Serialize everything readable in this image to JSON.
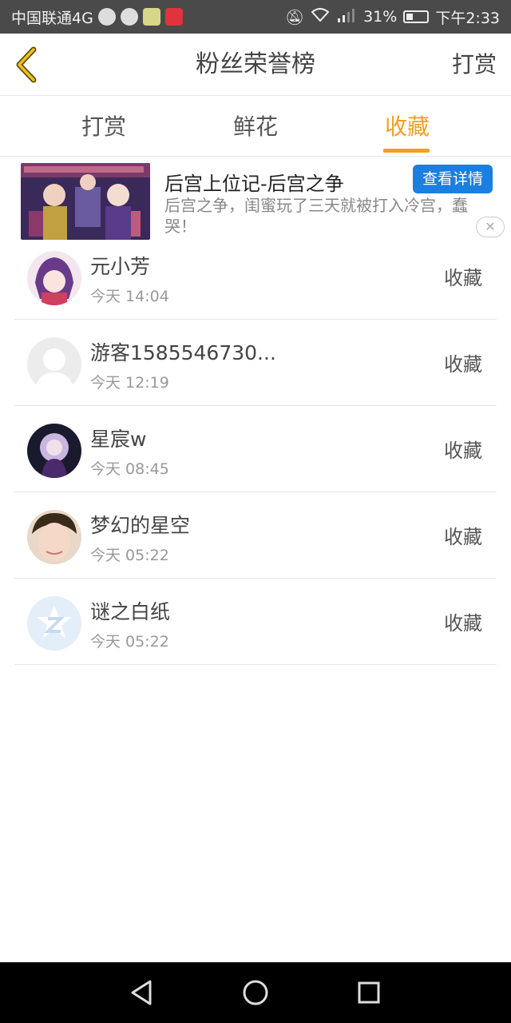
{
  "status_bar": {
    "carrier": "中国联通4G",
    "network": "4G",
    "battery": "31%",
    "time": "下午2:33"
  },
  "header": {
    "title": "粉丝荣誉榜",
    "right_action": "打赏"
  },
  "tabs": [
    {
      "label": "打赏",
      "active": false
    },
    {
      "label": "鲜花",
      "active": false
    },
    {
      "label": "收藏",
      "active": true
    }
  ],
  "accent_color": "#f0a020",
  "ad": {
    "title": "后宫上位记-后宫之争",
    "button": "查看详情",
    "description": "后宫之争，闺蜜玩了三天就被打入冷宫，蠢哭！",
    "close_symbol": "✕"
  },
  "list": [
    {
      "name": "元小芳",
      "time": "今天 14:04",
      "action": "收藏",
      "avatar": "anime-girl-avatar"
    },
    {
      "name": "游客1585546730...",
      "time": "今天 12:19",
      "action": "收藏",
      "avatar": "default-avatar"
    },
    {
      "name": "星宸w",
      "time": "今天 08:45",
      "action": "收藏",
      "avatar": "dark-anime-avatar"
    },
    {
      "name": "梦幻的星空",
      "time": "今天 05:22",
      "action": "收藏",
      "avatar": "photo-avatar"
    },
    {
      "name": "谜之白纸",
      "time": "今天 05:22",
      "action": "收藏",
      "avatar": "z-logo-avatar"
    }
  ]
}
